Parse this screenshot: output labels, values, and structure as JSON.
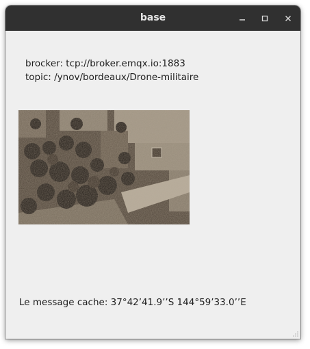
{
  "window": {
    "title": "base",
    "controls": {
      "minimize_icon": "minimize-icon",
      "maximize_icon": "maximize-icon",
      "close_icon": "close-icon"
    }
  },
  "connection": {
    "broker_line": "brocker: tcp://broker.emqx.io:1883",
    "topic_line": "topic: /ynov/bordeaux/Drone-militaire"
  },
  "image": {
    "description_icon": "aerial-photo"
  },
  "message": {
    "text": "Le message cache: 37°42’41.9’’S 144°59’33.0’’E"
  },
  "colors": {
    "titlebar": "#303030",
    "window_bg": "#efefef",
    "text": "#1e1e1e",
    "photo_tone": "#6e6152"
  }
}
